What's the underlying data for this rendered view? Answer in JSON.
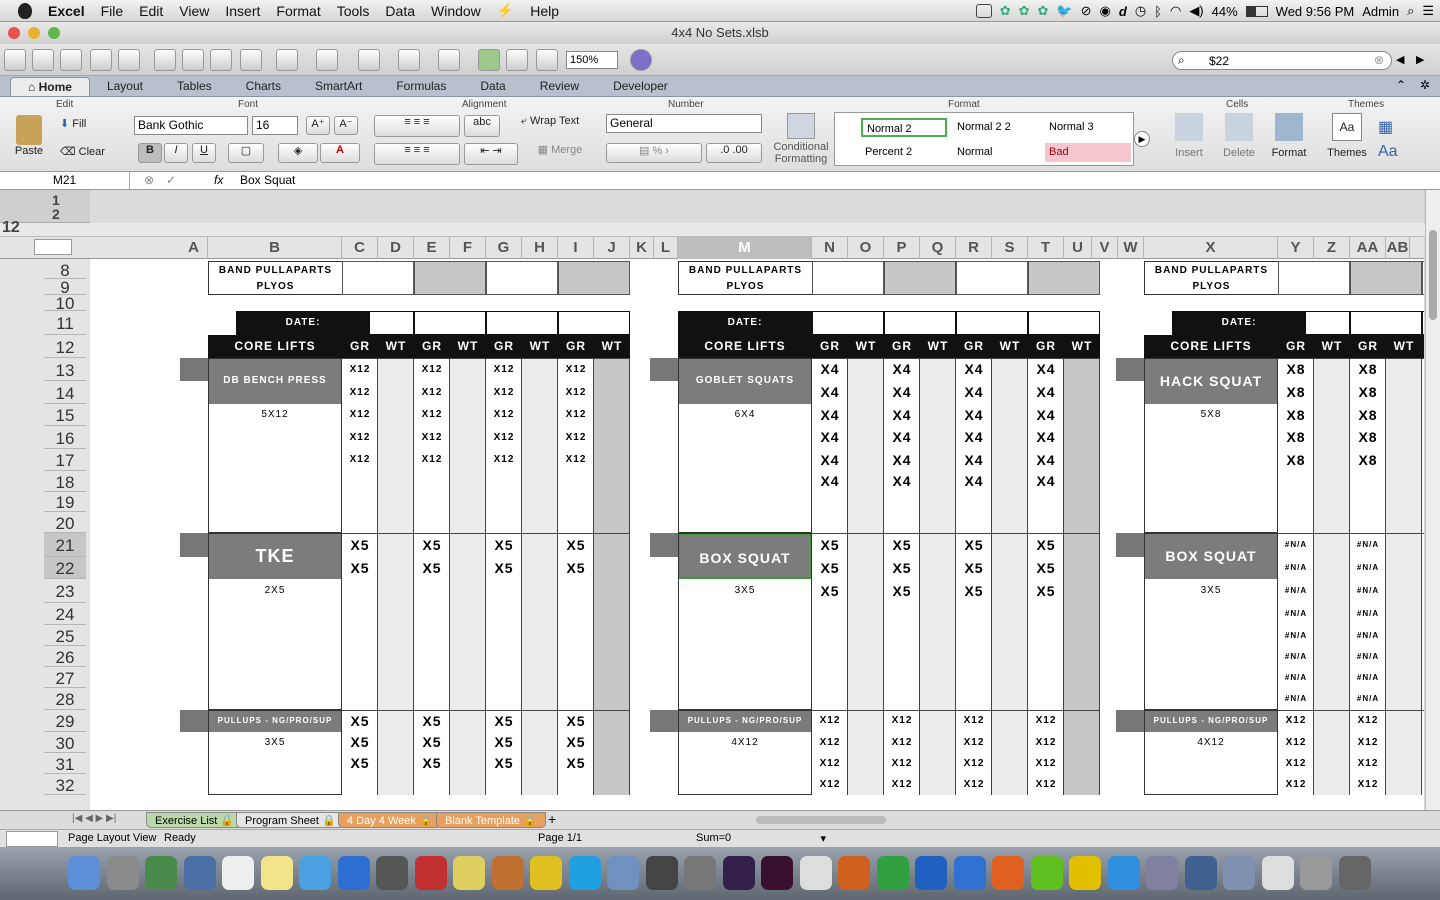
{
  "menubar": {
    "app": "Excel",
    "items": [
      "File",
      "Edit",
      "View",
      "Insert",
      "Format",
      "Tools",
      "Data",
      "Window",
      "Help"
    ],
    "battery": "44%",
    "clock": "Wed 9:56 PM",
    "user": "Admin"
  },
  "window": {
    "title": "4x4 No Sets.xlsb"
  },
  "toolbar": {
    "zoom": "150%",
    "search": "$22"
  },
  "ribbon_tabs": [
    "Home",
    "Layout",
    "Tables",
    "Charts",
    "SmartArt",
    "Formulas",
    "Data",
    "Review",
    "Developer"
  ],
  "ribbon": {
    "groups": {
      "edit": "Edit",
      "font": "Font",
      "alignment": "Alignment",
      "number": "Number",
      "format": "Format",
      "cells": "Cells",
      "themes": "Themes"
    },
    "paste": "Paste",
    "fill": "Fill",
    "clear": "Clear",
    "font_name": "Bank Gothic",
    "font_size": "16",
    "bold": "B",
    "italic": "I",
    "underline": "U",
    "wrap_text": "Wrap Text",
    "merge": "Merge",
    "number_format": "General",
    "abc": "abc",
    "cond_format": "Conditional Formatting",
    "styles": [
      "Normal 2",
      "Normal 2 2",
      "Normal 3",
      "Percent 2",
      "Normal",
      "Bad"
    ],
    "insert": "Insert",
    "delete": "Delete",
    "format": "Format",
    "themes": "Themes"
  },
  "formula_bar": {
    "cell_ref": "M21",
    "fx": "fx",
    "content": "Box Squat"
  },
  "ruler": {
    "top": "1",
    "bottom": "2",
    "side": "12"
  },
  "columns": [
    "A",
    "B",
    "C",
    "D",
    "E",
    "F",
    "G",
    "H",
    "I",
    "J",
    "K",
    "L",
    "M",
    "N",
    "O",
    "P",
    "Q",
    "R",
    "S",
    "T",
    "U",
    "V",
    "W",
    "X",
    "Y",
    "Z",
    "AA",
    "AB"
  ],
  "selected_column": "M",
  "rows": [
    "8",
    "9",
    "10",
    "11",
    "12",
    "13",
    "14",
    "15",
    "16",
    "17",
    "18",
    "19",
    "20",
    "21",
    "22",
    "23",
    "24",
    "25",
    "26",
    "27",
    "28",
    "29",
    "30",
    "31",
    "32"
  ],
  "selected_rows": [
    "21",
    "22"
  ],
  "sheet": {
    "band_pullaparts": "Band Pullaparts",
    "plyos": "Plyos",
    "date_label": "DATE:",
    "core_lifts": "Core Lifts",
    "gr": "GR",
    "wt": "WT",
    "blocks": [
      {
        "ex1": "DB Bench Press",
        "ex1_sets": "5x12",
        "ex1_reps": "x12",
        "ex1_rows": 5,
        "ex2": "TKE",
        "ex2_sets": "2x5",
        "ex2_reps": "x5",
        "ex2_rows": 2,
        "ex3": "Pullups - NG/PRO/SUP",
        "ex3_sets": "3x5",
        "ex3_reps": "x5",
        "ex3_rows": 3
      },
      {
        "ex1": "Goblet Squats",
        "ex1_sets": "6x4",
        "ex1_reps": "x4",
        "ex1_rows": 6,
        "ex2": "Box Squat",
        "ex2_sets": "3x5",
        "ex2_reps": "x5",
        "ex2_rows": 3,
        "ex3": "Pullups - NG/PRO/SUP",
        "ex3_sets": "4x12",
        "ex3_reps": "x12",
        "ex3_rows": 4
      },
      {
        "ex1": "Hack Squat",
        "ex1_sets": "5x8",
        "ex1_reps": "x8",
        "ex1_rows": 5,
        "ex2": "Box Squat",
        "ex2_sets": "3x5",
        "ex2_reps": "#N/A",
        "ex2_rows": 8,
        "ex3": "Pullups - NG/PRO/SUP",
        "ex3_sets": "4x12",
        "ex3_reps": "x12",
        "ex3_rows": 4
      }
    ]
  },
  "sheet_tabs": [
    "Exercise List",
    "Program Sheet",
    "4 Day 4 Week",
    "Blank Template"
  ],
  "status": {
    "view": "Page Layout View",
    "ready": "Ready",
    "page": "Page 1/1",
    "sum": "Sum=0"
  },
  "colors": {
    "dark": "#111111",
    "gray": "#7c7c7c",
    "tab_orange": "#e8a060",
    "bad_fill": "#f6c6cf"
  }
}
